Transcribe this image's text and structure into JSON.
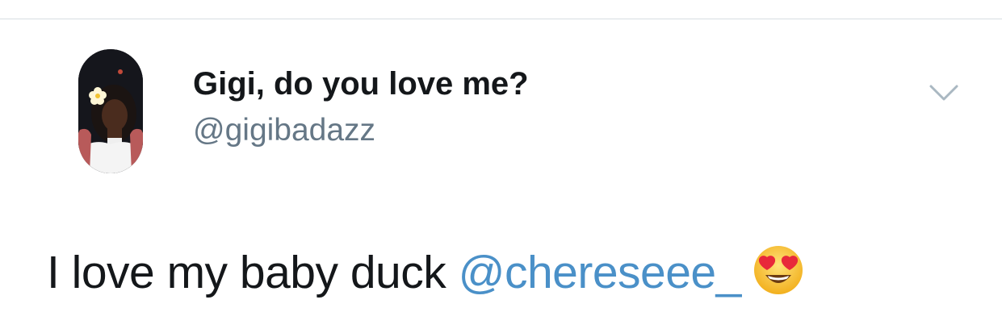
{
  "tweet": {
    "author": {
      "display_name": "Gigi, do you love me?",
      "handle": "@gigibadazz"
    },
    "text_prefix": "I love my baby duck ",
    "mention": "@chereseee_",
    "emoji": "heart-eyes-emoji"
  },
  "colors": {
    "text_primary": "#14171a",
    "text_secondary": "#657786",
    "link": "#4a90c8",
    "divider": "#d7dde2",
    "chevron": "#aab8c2"
  }
}
